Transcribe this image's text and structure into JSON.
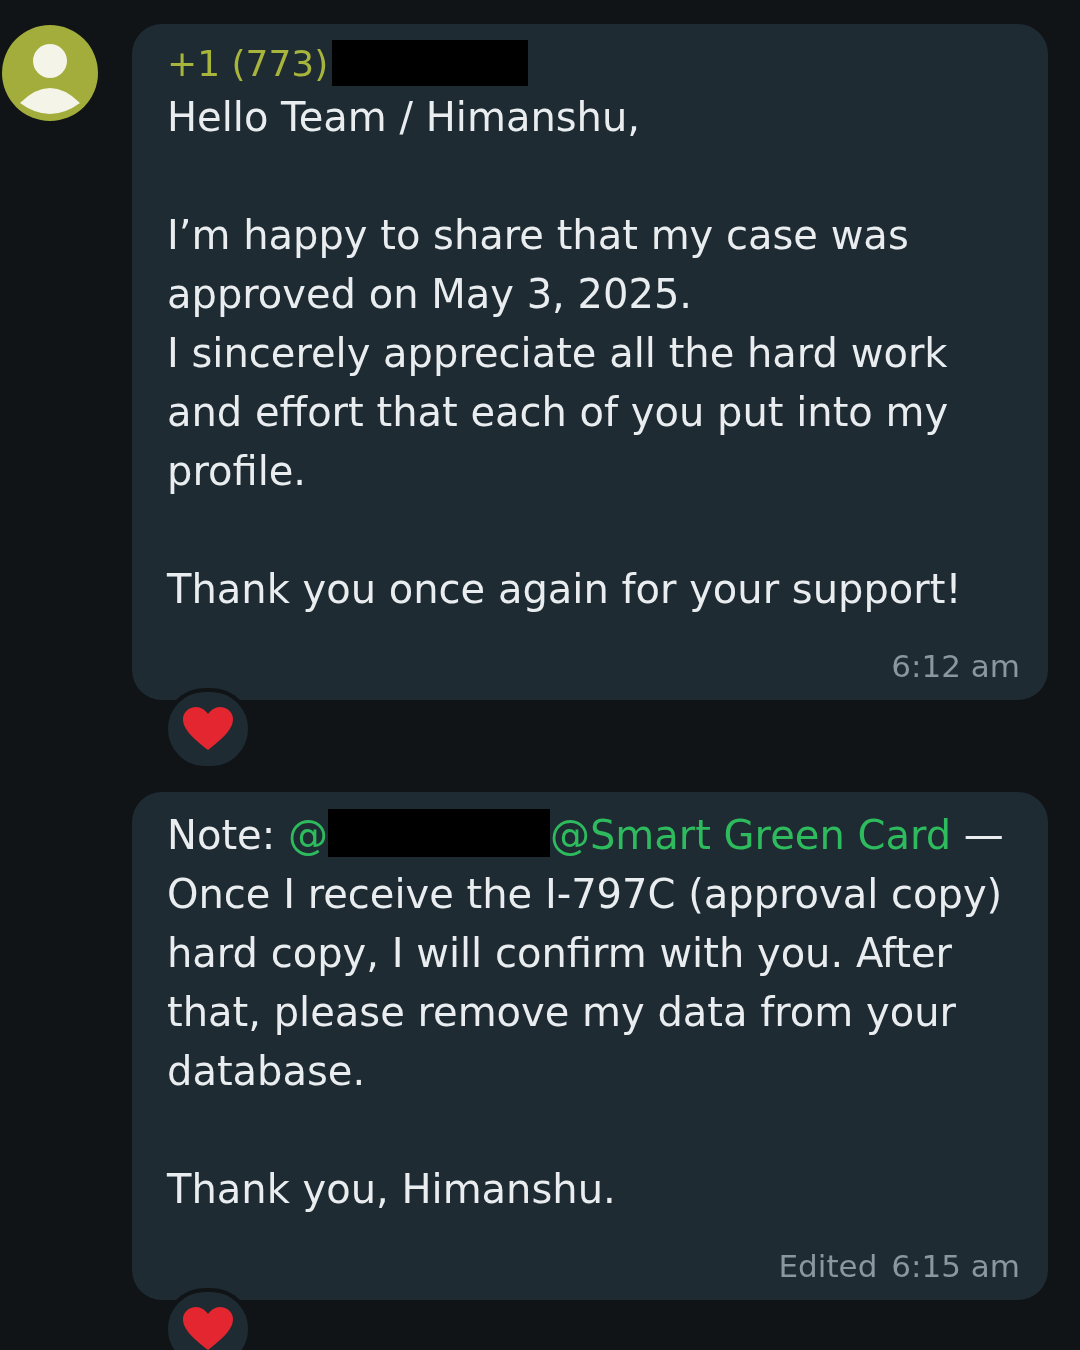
{
  "messages": [
    {
      "sender": {
        "text": "+1 (773)",
        "redacted": true
      },
      "paragraphs": [
        [
          {
            "kind": "plain",
            "text": "Hello Team / Himanshu,"
          }
        ],
        [
          {
            "kind": "plain",
            "text": "I’m happy to share that my case was approved on May 3, 2025.\nI sincerely appreciate all the hard work and effort that each of you put into my profile."
          }
        ],
        [
          {
            "kind": "plain",
            "text": "Thank you once again for your support!"
          }
        ]
      ],
      "time": "6:12 am",
      "reaction": {
        "kind": "heart"
      }
    },
    {
      "paragraphs": [
        [
          {
            "kind": "plain",
            "text": "Note: "
          },
          {
            "kind": "mention",
            "text": "@"
          },
          {
            "kind": "redaction"
          },
          {
            "kind": "mention",
            "text": "@Smart Green Card"
          },
          {
            "kind": "plain",
            "text": " — Once I receive the I-797C (approval copy) hard copy, I will confirm with you. After that, please remove my data from your database."
          }
        ],
        [
          {
            "kind": "plain",
            "text": "Thank you, Himanshu."
          }
        ]
      ],
      "edited_label": "Edited",
      "time": "6:15 am",
      "reaction": {
        "kind": "heart"
      }
    }
  ]
}
